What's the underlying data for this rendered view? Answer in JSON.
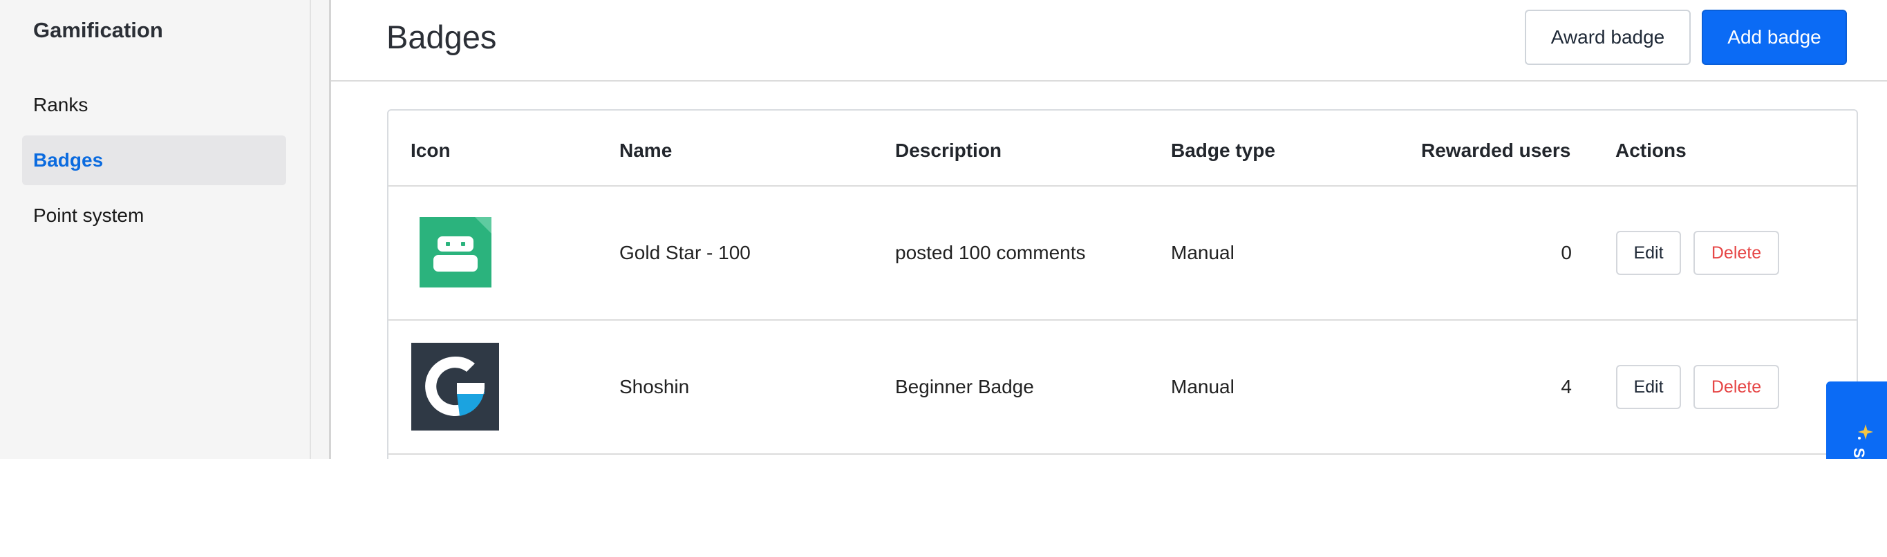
{
  "sidebar": {
    "title": "Gamification",
    "items": [
      {
        "label": "Ranks"
      },
      {
        "label": "Badges"
      },
      {
        "label": "Point system"
      }
    ]
  },
  "header": {
    "title": "Badges",
    "award_label": "Award badge",
    "add_label": "Add badge"
  },
  "table": {
    "columns": [
      "Icon",
      "Name",
      "Description",
      "Badge type",
      "Rewarded users",
      "Actions"
    ],
    "rows": [
      {
        "icon": "robot-badge-icon",
        "name": "Gold Star - 100",
        "description": "posted 100 comments",
        "badge_type": "Manual",
        "rewarded_users": "0",
        "edit_label": "Edit",
        "delete_label": "Delete"
      },
      {
        "icon": "g-logo-badge-icon",
        "name": "Shoshin",
        "description": "Beginner Badge",
        "badge_type": "Manual",
        "rewarded_users": "4",
        "edit_label": "Edit",
        "delete_label": "Delete"
      }
    ]
  },
  "float_tab": {
    "label": "SO",
    "icon": "sparkle-icon"
  },
  "colors": {
    "accent": "#0b6bf5",
    "active_nav": "#0b6bdf",
    "delete_red": "#e64545",
    "badge_green": "#2bb37d",
    "badge_dark": "#2f3945"
  }
}
